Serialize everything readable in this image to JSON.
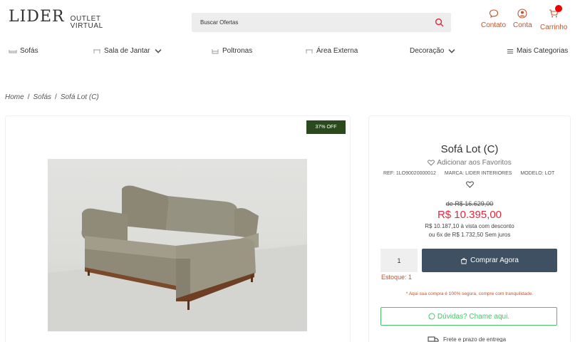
{
  "header": {
    "logo_main": "LIDER",
    "logo_sub_line1": "OUTLET",
    "logo_sub_line2": "VIRTUAL",
    "search_placeholder": "Buscar Ofertas",
    "contact_label": "Contato",
    "account_label": "Conta",
    "cart_label": "Carrinho"
  },
  "nav": {
    "items": [
      {
        "label": "Sofás",
        "icon": "sofa-icon"
      },
      {
        "label": "Sala de Jantar",
        "icon": "table-icon",
        "dropdown": true
      },
      {
        "label": "Poltronas",
        "icon": "armchair-icon"
      },
      {
        "label": "Área Externa",
        "icon": "outdoor-icon"
      },
      {
        "label": "Decoração",
        "dropdown": true
      },
      {
        "label": "Mais Categorias",
        "icon": "menu-icon"
      }
    ]
  },
  "breadcrumb": {
    "items": [
      "Home",
      "Sofás",
      "Sofá Lot (C)"
    ],
    "separator": "/"
  },
  "product": {
    "discount_badge": "37% OFF",
    "title": "Sofá Lot (C)",
    "favorite_label": "Adicionar aos Favoritos",
    "ref": "REF: 1LO90020000012",
    "brand": "MARCA: LIDER INTERIORES",
    "model": "MODELO: LOT",
    "old_price": "de R$ 16.629,00",
    "price": "R$ 10.395,00",
    "installment_line1": "R$ 10.187,10 à vista com desconto",
    "installment_line2": "ou 6x de R$ 1.732,50 Sem juros",
    "quantity": "1",
    "buy_label": "Comprar Agora",
    "stock_label": "Estoque: 1",
    "secure_note": "* Aqui sua compra é 100% segura, compre com tranquilidade.",
    "whatsapp_label": "Dúvidas? Chame aqui.",
    "shipping_label": "Frete e prazo de entrega"
  },
  "colors": {
    "accent": "#c0532f",
    "price": "#e0283c",
    "buy_button": "#3e5062",
    "whatsapp": "#49c26a",
    "badge": "#2a4a1e"
  }
}
